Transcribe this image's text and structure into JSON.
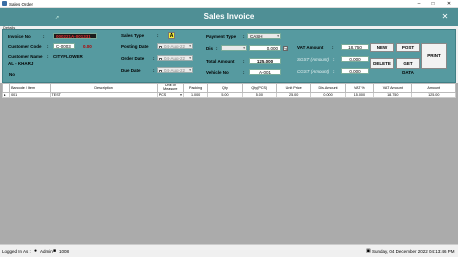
{
  "window": {
    "title": "Sales Order"
  },
  "header": {
    "title": "Sales Invoice",
    "close": "✕"
  },
  "details_label": "Details",
  "left": {
    "invoice_no_label": "Invoice No",
    "invoice_no_value": "000221A-001331",
    "customer_code_label": "Customer Code",
    "customer_code_value": "C-0003",
    "customer_balance": "0.00",
    "customer_name_label": "Customer Name",
    "customer_name_value": "CITYFLOWER",
    "customer_address": "AL - KHARJ",
    "no_label": "No"
  },
  "middle": {
    "sales_type_label": "Sales Type",
    "sales_type_value": "A",
    "posting_date_label": "Posting Date",
    "posting_date_value": "04-Aug-22",
    "order_date_label": "Order Date",
    "order_date_value": "04-Aug-22",
    "due_date_label": "Due Date",
    "due_date_value": "04-Aug-22"
  },
  "right": {
    "payment_type_label": "Payment Type",
    "payment_type_value": "CASH",
    "dis_label": "Dis",
    "dis_value": "0.000",
    "pct_symbol": "%",
    "total_amount_label": "Total Amount",
    "total_amount_value": "125.000",
    "vehicle_no_label": "Vehicle No",
    "vehicle_no_value": "A-001",
    "vat_amount_label": "VAT Amount",
    "vat_amount_value": "18.750",
    "sgst_label": "SGST (Amount)",
    "sgst_value": "0.000",
    "cgst_label": "CGST (Amount)",
    "cgst_value": "0.000"
  },
  "buttons": {
    "new": "NEW",
    "post": "POST",
    "delete": "DELETE",
    "get_data": "GET DATA",
    "print": "PRINT"
  },
  "table": {
    "columns": [
      "Barcode / Item",
      "Description",
      "Unit of Measure",
      "Packing",
      "Qty",
      "Qty(PCS)",
      "Unit Price",
      "Dis.Amount",
      "VAT %",
      "VAT Amount",
      "Amount"
    ],
    "rows": [
      [
        "001",
        "TEST",
        "PCS",
        "1.000",
        "5.00",
        "5.00",
        "25.00",
        "0.000",
        "15.000",
        "18.750",
        "125.00"
      ]
    ]
  },
  "status": {
    "logged_in_label": "Logged In As :",
    "user": "Admin",
    "user_id": "1008",
    "datetime": "Sunday, 04 December 2022 04:13:46 PM"
  }
}
